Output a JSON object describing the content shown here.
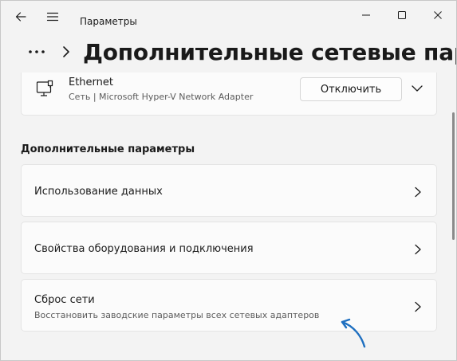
{
  "window": {
    "app_title": "Параметры"
  },
  "breadcrumb": {
    "page_title": "Дополнительные сетевые параметры"
  },
  "adapter": {
    "name": "Ethernet",
    "description": "Сеть | Microsoft Hyper-V Network Adapter",
    "disconnect_label": "Отключить"
  },
  "advanced": {
    "section_title": "Дополнительные параметры",
    "items": [
      {
        "label": "Использование данных"
      },
      {
        "label": "Свойства оборудования и подключения"
      },
      {
        "label": "Сброс сети",
        "sublabel": "Восстановить заводские параметры всех сетевых адаптеров"
      }
    ]
  },
  "colors": {
    "background": "#f3f3f3",
    "card": "#fbfbfb",
    "arrow_annotation": "#1e6fc0"
  }
}
